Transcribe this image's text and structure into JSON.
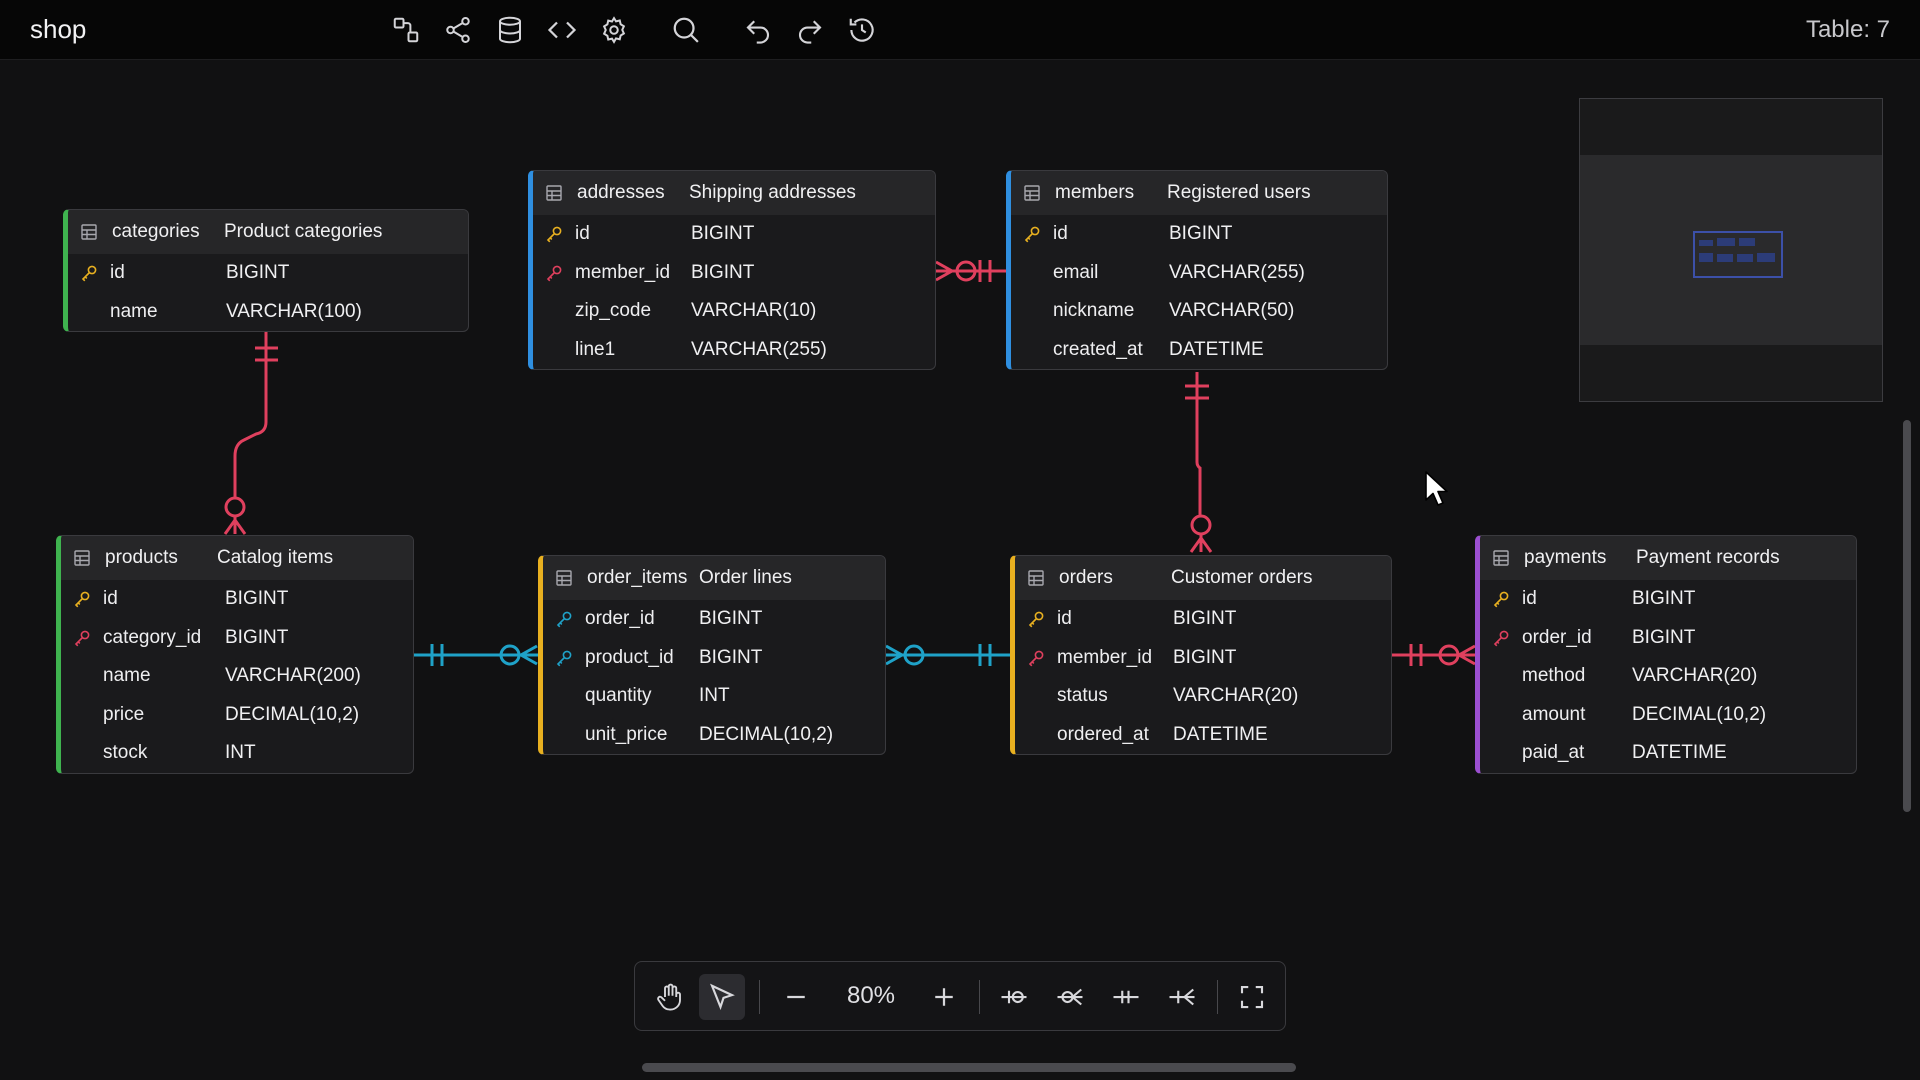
{
  "app": {
    "title": "shop",
    "table_count": "Table: 7"
  },
  "toolbar": {
    "icons": [
      "diagram-icon",
      "share-icon",
      "database-icon",
      "code-icon",
      "gear-icon",
      "search-icon",
      "undo-icon",
      "redo-icon",
      "history-icon"
    ]
  },
  "tables": {
    "categories": {
      "name": "categories",
      "comment": "Product categories",
      "accent": "#3fb34f",
      "columns": [
        {
          "name": "id",
          "type": "BIGINT",
          "key": "pk"
        },
        {
          "name": "name",
          "type": "VARCHAR(100)",
          "key": ""
        }
      ]
    },
    "addresses": {
      "name": "addresses",
      "comment": "Shipping addresses",
      "accent": "#2f8fe0",
      "columns": [
        {
          "name": "id",
          "type": "BIGINT",
          "key": "pk"
        },
        {
          "name": "member_id",
          "type": "BIGINT",
          "key": "fk"
        },
        {
          "name": "zip_code",
          "type": "VARCHAR(10)",
          "key": ""
        },
        {
          "name": "line1",
          "type": "VARCHAR(255)",
          "key": ""
        }
      ]
    },
    "members": {
      "name": "members",
      "comment": "Registered users",
      "accent": "#2f8fe0",
      "columns": [
        {
          "name": "id",
          "type": "BIGINT",
          "key": "pk"
        },
        {
          "name": "email",
          "type": "VARCHAR(255)",
          "key": ""
        },
        {
          "name": "nickname",
          "type": "VARCHAR(50)",
          "key": ""
        },
        {
          "name": "created_at",
          "type": "DATETIME",
          "key": ""
        }
      ]
    },
    "products": {
      "name": "products",
      "comment": "Catalog items",
      "accent": "#3fb34f",
      "columns": [
        {
          "name": "id",
          "type": "BIGINT",
          "key": "pk"
        },
        {
          "name": "category_id",
          "type": "BIGINT",
          "key": "fk"
        },
        {
          "name": "name",
          "type": "VARCHAR(200)",
          "key": ""
        },
        {
          "name": "price",
          "type": "DECIMAL(10,2)",
          "key": ""
        },
        {
          "name": "stock",
          "type": "INT",
          "key": ""
        }
      ]
    },
    "order_items": {
      "name": "order_items",
      "comment": "Order lines",
      "accent": "#e8b020",
      "columns": [
        {
          "name": "order_id",
          "type": "BIGINT",
          "key": "pfk"
        },
        {
          "name": "product_id",
          "type": "BIGINT",
          "key": "pfk"
        },
        {
          "name": "quantity",
          "type": "INT",
          "key": ""
        },
        {
          "name": "unit_price",
          "type": "DECIMAL(10,2)",
          "key": ""
        }
      ]
    },
    "orders": {
      "name": "orders",
      "comment": "Customer orders",
      "accent": "#e8b020",
      "columns": [
        {
          "name": "id",
          "type": "BIGINT",
          "key": "pk"
        },
        {
          "name": "member_id",
          "type": "BIGINT",
          "key": "fk"
        },
        {
          "name": "status",
          "type": "VARCHAR(20)",
          "key": ""
        },
        {
          "name": "ordered_at",
          "type": "DATETIME",
          "key": ""
        }
      ]
    },
    "payments": {
      "name": "payments",
      "comment": "Payment records",
      "accent": "#9b4fd0",
      "columns": [
        {
          "name": "id",
          "type": "BIGINT",
          "key": "pk"
        },
        {
          "name": "order_id",
          "type": "BIGINT",
          "key": "fk"
        },
        {
          "name": "method",
          "type": "VARCHAR(20)",
          "key": ""
        },
        {
          "name": "amount",
          "type": "DECIMAL(10,2)",
          "key": ""
        },
        {
          "name": "paid_at",
          "type": "DATETIME",
          "key": ""
        }
      ]
    }
  },
  "colors": {
    "pk": "#e8b020",
    "fk": "#e0405e",
    "pfk": "#1fa2c8",
    "relation_red": "#e0405e",
    "relation_blue": "#1fa2c8"
  },
  "bottom_toolbar": {
    "zoom": "80%",
    "tools": [
      "hand-icon",
      "pointer-icon",
      "zoom-out-icon",
      "zoom-in-icon",
      "one-or-zero-icon",
      "zero-or-many-icon",
      "one-and-only-one-icon",
      "one-or-many-icon",
      "fullscreen-icon"
    ]
  }
}
